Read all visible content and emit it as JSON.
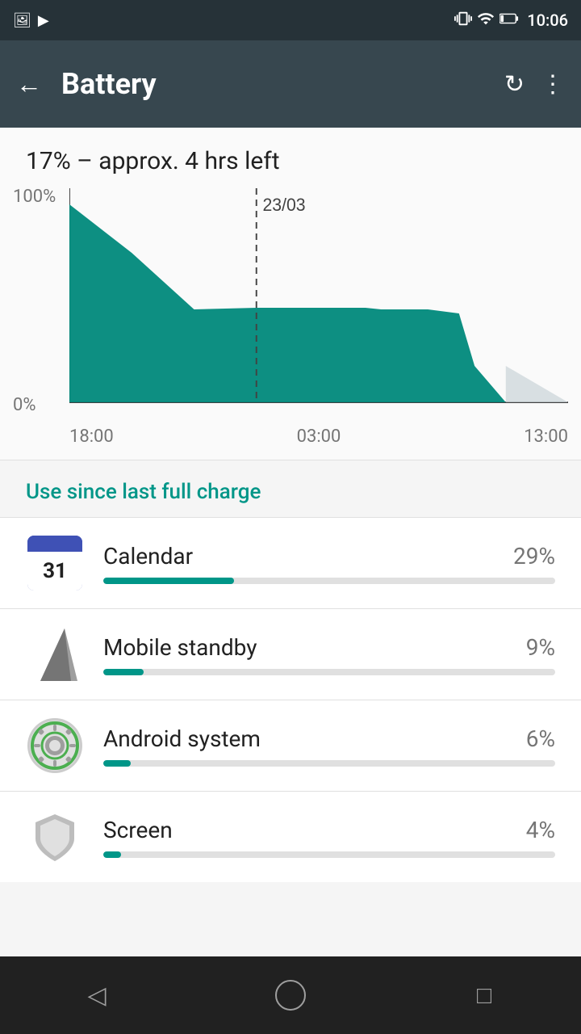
{
  "statusBar": {
    "time": "10:06",
    "icons": [
      "photo",
      "shop",
      "vibrate",
      "signal",
      "battery"
    ]
  },
  "appBar": {
    "title": "Battery",
    "backLabel": "←",
    "refreshLabel": "↻",
    "moreLabel": "⋮"
  },
  "batteryStatus": {
    "text": "17% – approx. 4 hrs left"
  },
  "chart": {
    "yLabels": [
      "100%",
      "0%"
    ],
    "xLabels": [
      "18:00",
      "03:00",
      "13:00"
    ],
    "dateLine": "23/03"
  },
  "sectionHeader": {
    "text": "Use since last full charge"
  },
  "apps": [
    {
      "name": "Calendar",
      "percent": "29%",
      "percentNum": 29,
      "iconType": "calendar",
      "iconText": "31"
    },
    {
      "name": "Mobile standby",
      "percent": "9%",
      "percentNum": 9,
      "iconType": "signal"
    },
    {
      "name": "Android system",
      "percent": "6%",
      "percentNum": 6,
      "iconType": "android"
    },
    {
      "name": "Screen",
      "percent": "4%",
      "percentNum": 4,
      "iconType": "screen"
    }
  ],
  "bottomNav": {
    "back": "◁",
    "home": "○",
    "recents": "□"
  }
}
